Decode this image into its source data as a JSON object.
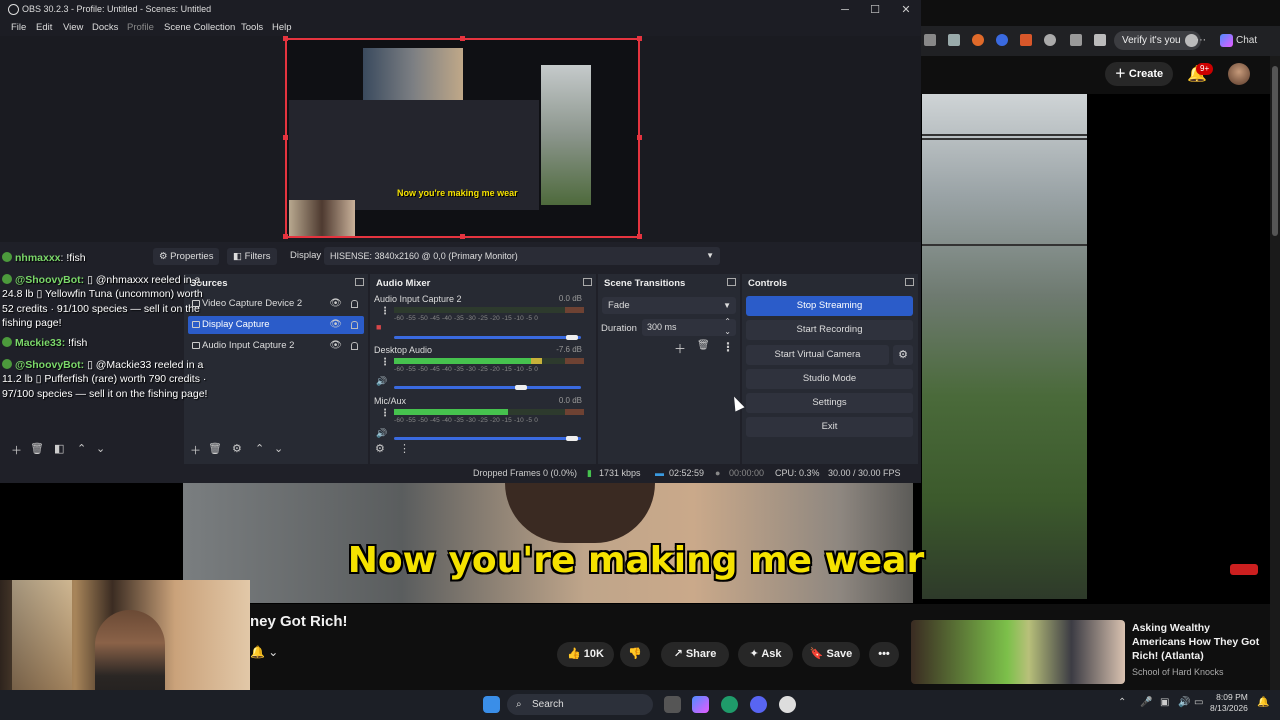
{
  "obs": {
    "title": "OBS 30.2.3 - Profile: Untitled - Scenes: Untitled",
    "menu": [
      "File",
      "Edit",
      "View",
      "Docks",
      "Profile",
      "Scene Collection",
      "Tools",
      "Help"
    ],
    "toolbar": {
      "properties": "Properties",
      "filters": "Filters",
      "display_label": "Display",
      "display_value": "HISENSE: 3840x2160 @ 0,0 (Primary Monitor)"
    },
    "preview_subtitle": "Now you're making me wear",
    "sources": {
      "title": "Sources",
      "items": [
        {
          "label": "Video Capture Device 2",
          "selected": false
        },
        {
          "label": "Display Capture",
          "selected": true
        },
        {
          "label": "Audio Input Capture 2",
          "selected": false
        }
      ]
    },
    "mixer": {
      "title": "Audio Mixer",
      "channels": [
        {
          "name": "Audio Input Capture 2",
          "db": "0.0 dB",
          "level": 0.0,
          "volume": 0.95
        },
        {
          "name": "Desktop Audio",
          "db": "-7.6 dB",
          "level": 0.78,
          "volume": 0.68
        },
        {
          "name": "Mic/Aux",
          "db": "0.0 dB",
          "level": 0.6,
          "volume": 0.95
        }
      ],
      "scale": "-60 -55 -50 -45 -40 -35 -30 -25 -20 -15 -10 -5 0"
    },
    "transitions": {
      "title": "Scene Transitions",
      "type": "Fade",
      "duration_label": "Duration",
      "duration_value": "300 ms"
    },
    "controls": {
      "title": "Controls",
      "stop_streaming": "Stop Streaming",
      "start_recording": "Start Recording",
      "start_virtual_camera": "Start Virtual Camera",
      "studio_mode": "Studio Mode",
      "settings": "Settings",
      "exit": "Exit"
    },
    "status": {
      "dropped_frames": "Dropped Frames 0 (0.0%)",
      "bitrate": "1731 kbps",
      "stream_time": "02:52:59",
      "record_time": "00:00:00",
      "cpu": "CPU: 0.3%",
      "fps": "30.00 / 30.00 FPS"
    }
  },
  "chat": [
    {
      "user": "nhmaxxx",
      "text": "!fish"
    },
    {
      "user": "@ShoovyBot:",
      "text": "▯ @nhmaxxx reeled in a 24.8 lb ▯ Yellowfin Tuna (uncommon) worth 52 credits · 91/100 species — sell it on the fishing page!"
    },
    {
      "user": "Mackie33:",
      "text": "!fish"
    },
    {
      "user": "@ShoovyBot:",
      "text": "▯ @Mackie33 reeled in a 11.2 lb ▯ Pufferfish (rare) worth 790 credits · 97/100 species — sell it on the fishing page!"
    }
  ],
  "youtube": {
    "subtitle": "Now you're making me wear",
    "video_title": "ney Got Rich!",
    "likes": "10K",
    "share": "Share",
    "ask": "Ask",
    "save": "Save",
    "create": "Create",
    "notif_count": "9+",
    "verify": "Verify it's you",
    "chat": "Chat",
    "rec_title": "Asking Wealthy Americans How They Got Rich! (Atlanta)",
    "rec_channel": "School of Hard Knocks"
  },
  "taskbar": {
    "search": "Search",
    "time": "8:09 PM",
    "date": "8/13/2026"
  }
}
